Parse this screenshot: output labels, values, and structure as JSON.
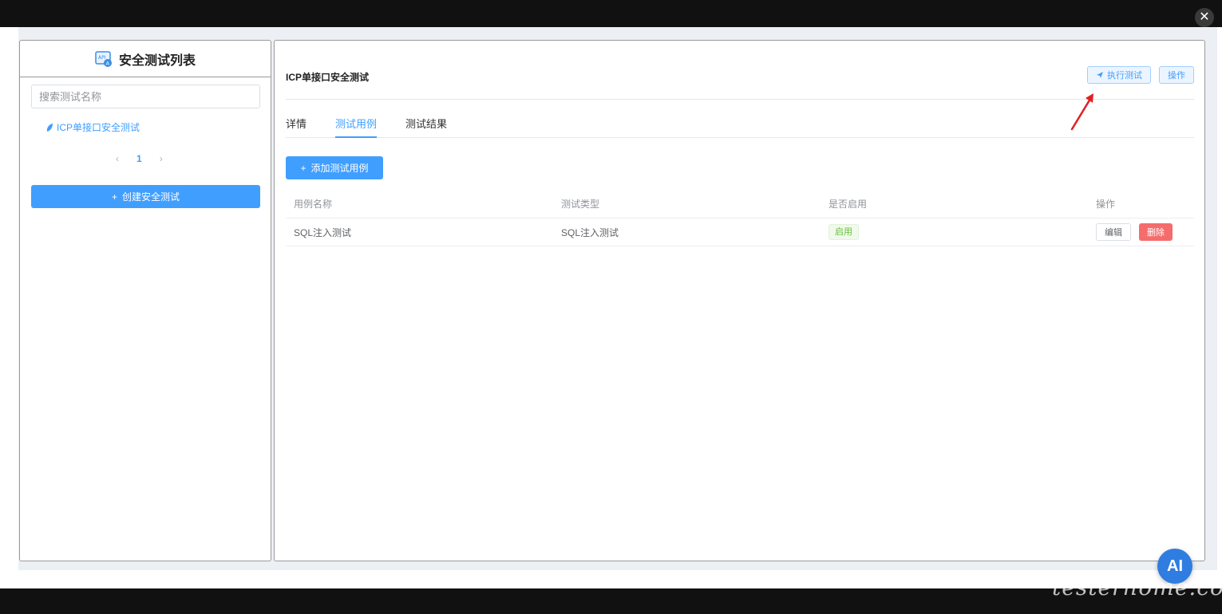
{
  "window": {
    "close_symbol": "✕"
  },
  "sidebar": {
    "title": "安全测试列表",
    "title_icon": "api-icon",
    "search_placeholder": "搜索测试名称",
    "items": [
      {
        "label": "ICP单接口安全测试",
        "icon": "leaf-icon"
      }
    ],
    "pager": {
      "prev": "‹",
      "page": "1",
      "next": "›"
    },
    "create_button": {
      "icon": "+",
      "label": "创建安全测试"
    }
  },
  "main": {
    "title": "ICP单接口安全测试",
    "run_button": {
      "icon": "send-icon",
      "label": "执行测试"
    },
    "ops_button": "操作",
    "tabs": [
      {
        "label": "详情"
      },
      {
        "label": "测试用例",
        "active": true
      },
      {
        "label": "测试结果"
      }
    ],
    "add_button": {
      "icon": "+",
      "label": "添加测试用例"
    },
    "table": {
      "headers": [
        "用例名称",
        "测试类型",
        "是否启用",
        "操作"
      ],
      "rows": [
        {
          "name": "SQL注入测试",
          "type": "SQL注入测试",
          "enabled": "启用",
          "edit": "编辑",
          "delete": "删除"
        }
      ]
    }
  },
  "overlay": {
    "ai_badge": "AI",
    "watermark": "testerhome.com"
  },
  "colors": {
    "primary": "#409eff",
    "success": "#67c23a",
    "danger": "#f56c6c",
    "arrow": "#e02020"
  }
}
